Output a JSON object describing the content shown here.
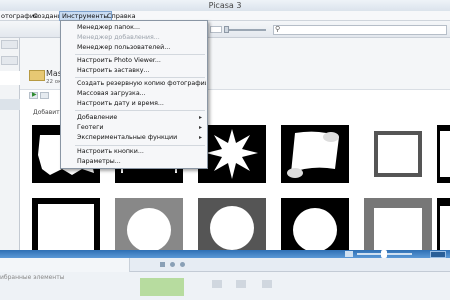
{
  "window": {
    "title": "Picasa 3"
  },
  "menubar": {
    "items": [
      "отография",
      "Создание",
      "Инструменты",
      "Справка"
    ]
  },
  "dropdown": {
    "items": [
      {
        "label": "Менеджер папок...",
        "disabled": false,
        "submenu": false
      },
      {
        "label": "Менеджер добавления...",
        "disabled": true,
        "submenu": false
      },
      {
        "label": "Менеджер пользователей...",
        "disabled": false,
        "submenu": false
      },
      {
        "label": "Настроить Photo Viewer...",
        "disabled": false,
        "submenu": false
      },
      {
        "label": "Настроить заставку...",
        "disabled": false,
        "submenu": false
      },
      {
        "label": "Создать резервную копию фотографий...",
        "disabled": false,
        "submenu": false
      },
      {
        "label": "Массовая загрузка...",
        "disabled": false,
        "submenu": false
      },
      {
        "label": "Настроить дату и время...",
        "disabled": false,
        "submenu": false
      },
      {
        "label": "Добавление",
        "disabled": false,
        "submenu": true
      },
      {
        "label": "Геотеги",
        "disabled": false,
        "submenu": true
      },
      {
        "label": "Экспериментальные функции",
        "disabled": false,
        "submenu": true
      },
      {
        "label": "Настроить кнопки...",
        "disabled": false,
        "submenu": false
      },
      {
        "label": "Параметры...",
        "disabled": false,
        "submenu": false
      }
    ],
    "submenu_arrow": "▸"
  },
  "folder": {
    "name_fragment": "Mas",
    "date_fragment": "22 окт",
    "add_text_fragment": "Добавить о"
  },
  "toolbar": {
    "row_number_fragment": "2"
  },
  "tray": {
    "label_fragment": "ибранные элементы"
  },
  "colors": {
    "accent": "#2e6fb4",
    "menu_highlight": "#c9dcf2"
  }
}
